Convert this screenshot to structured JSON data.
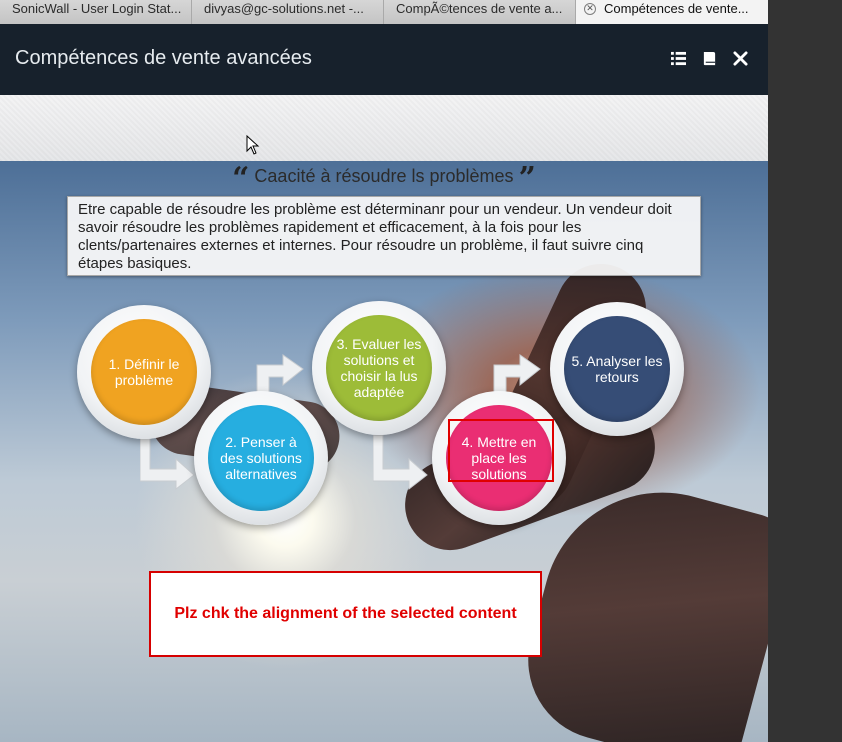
{
  "tabs": [
    {
      "label": "SonicWall - User Login Stat..."
    },
    {
      "label": "divyas@gc-solutions.net -..."
    },
    {
      "label": "CompÃ©tences de vente a..."
    },
    {
      "label": "Compétences de vente...",
      "active": true
    }
  ],
  "header": {
    "title": "Compétences de vente avancées",
    "icons": [
      "list-icon",
      "book-icon",
      "close-icon"
    ]
  },
  "slide": {
    "quote_open": "“",
    "title": "Caacité à résoudre ls problèmes",
    "quote_close": "”",
    "description": "Etre capable de résoudre les problème est déterminanr pour un vendeur. Un vendeur doit savoir résoudre les problèmes rapidement et efficacement, à la fois pour les clents/partenaires externes et internes. Pour résoudre un problème, il faut suivre cinq étapes basiques.",
    "steps": [
      {
        "label": "1. Définir le problème",
        "color": "#f0a321"
      },
      {
        "label": "2. Penser à des solutions alternatives",
        "color": "#26aee0"
      },
      {
        "label": "3. Evaluer les solutions et choisir la lus adaptée",
        "color": "#9dbc38"
      },
      {
        "label": "4. Mettre en place les solutions",
        "color": "#ea2e73"
      },
      {
        "label": "5. Analyser les retours",
        "color": "#364d76"
      }
    ],
    "annotation": "Plz chk the alignment of the selected content"
  }
}
